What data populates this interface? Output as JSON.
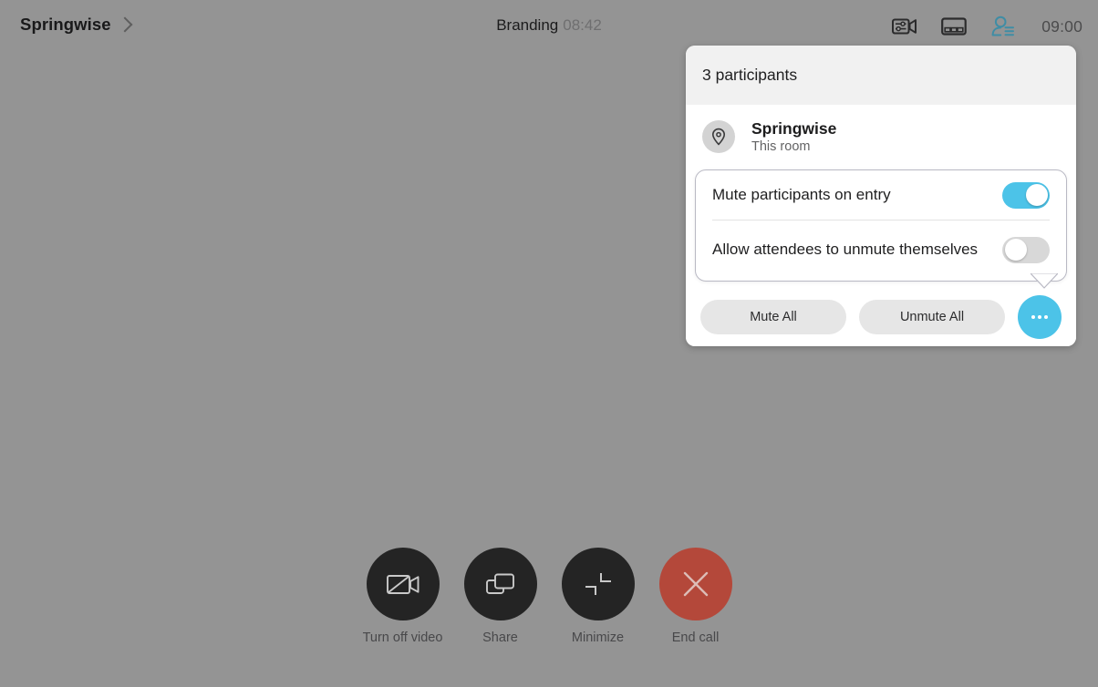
{
  "topbar": {
    "brand": "Springwise",
    "brand_chevron_icon": "chevron-right-icon",
    "meeting_title": "Branding",
    "meeting_elapsed": "08:42",
    "clock": "09:00",
    "icons": [
      {
        "name": "camera-settings-icon",
        "label": "Camera settings"
      },
      {
        "name": "layout-icon",
        "label": "Layout"
      },
      {
        "name": "participants-icon",
        "label": "Participants"
      }
    ],
    "participants_icon_color": "#3f8da5"
  },
  "participants_panel": {
    "header": "3 participants",
    "participants": [
      {
        "avatar_icon": "location-pin-icon",
        "name": "Springwise",
        "subtitle": "This room"
      },
      {
        "avatar_icon": "person-photo-avatar",
        "name": "",
        "subtitle": ""
      }
    ],
    "footer": {
      "mute_all": "Mute All",
      "unmute_all": "Unmute All",
      "more_icon": "ellipsis-icon",
      "more_color": "#4cc3e8"
    }
  },
  "settings_popover": {
    "rows": [
      {
        "label": "Mute participants on entry",
        "state": "on"
      },
      {
        "label": "Allow attendees to unmute themselves",
        "state": "off"
      }
    ],
    "toggle_on_color": "#4cc3e8",
    "toggle_off_color": "#d8d8d8"
  },
  "toolbar": {
    "buttons": [
      {
        "icon": "video-off-icon",
        "label": "Turn off video",
        "variant": "dark"
      },
      {
        "icon": "share-screen-icon",
        "label": "Share",
        "variant": "dark"
      },
      {
        "icon": "minimize-icon",
        "label": "Minimize",
        "variant": "dark"
      },
      {
        "icon": "end-call-icon",
        "label": "End call",
        "variant": "danger"
      }
    ],
    "danger_color": "#b4483a"
  }
}
